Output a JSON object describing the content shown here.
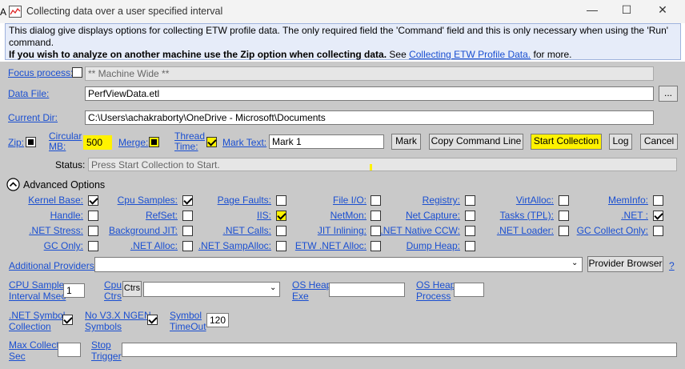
{
  "window": {
    "title": "Collecting data over a user specified interval",
    "minimize": "—",
    "maximize": "☐",
    "close": "✕"
  },
  "info": {
    "line1": "This dialog give displays options for collecting ETW profile data. The only required field the 'Command' field and this is only necessary when using the 'Run'",
    "line2": "command.",
    "line3_bold": "If you wish to analyze on another machine use the Zip option when collecting data.",
    "line3_see": " See ",
    "line3_link": "Collecting ETW Profile Data.",
    "line3_tail": " for more."
  },
  "form": {
    "focus_process_label": "Focus process:",
    "focus_process_value": "** Machine Wide **",
    "data_file_label": "Data File:",
    "data_file_value": "PerfViewData.etl",
    "browse_label": "...",
    "current_dir_label": "Current Dir:",
    "current_dir_value": "C:\\Users\\achakraborty\\OneDrive - Microsoft\\Documents",
    "zip_label": "Zip:",
    "circular_label_1": "Circular",
    "circular_label_2": "MB:",
    "circular_value": "500",
    "merge_label": "Merge:",
    "thread_time_label_1": "Thread",
    "thread_time_label_2": "Time:",
    "mark_text_label": "Mark Text:",
    "mark_text_value": "Mark 1",
    "mark_button": "Mark",
    "copy_command_button": "Copy Command Line",
    "start_collection_button": "Start Collection",
    "log_button": "Log",
    "cancel_button": "Cancel",
    "status_label": "Status:",
    "status_value": "Press Start Collection to Start."
  },
  "advanced": {
    "toggle_icon": "chevron-up-icon",
    "label": "Advanced Options",
    "options": [
      {
        "label": "Kernel Base:",
        "checked": true
      },
      {
        "label": "Cpu Samples:",
        "checked": true
      },
      {
        "label": "Page Faults:",
        "checked": false
      },
      {
        "label": "File I/O:",
        "checked": false
      },
      {
        "label": "Registry:",
        "checked": false
      },
      {
        "label": "VirtAlloc:",
        "checked": false
      },
      {
        "label": "MemInfo:",
        "checked": false
      },
      {
        "label": "Handle:",
        "checked": false
      },
      {
        "label": "RefSet:",
        "checked": false
      },
      {
        "label": "IIS:",
        "checked": true
      },
      {
        "label": "NetMon:",
        "checked": false
      },
      {
        "label": "Net Capture:",
        "checked": false
      },
      {
        "label": "Tasks (TPL):",
        "checked": false
      },
      {
        "label": ".NET :",
        "checked": true
      },
      {
        "label": ".NET Stress:",
        "checked": false
      },
      {
        "label": "Background JIT:",
        "checked": false
      },
      {
        "label": ".NET Calls:",
        "checked": false
      },
      {
        "label": "JIT Inlining:",
        "checked": false
      },
      {
        "label": ".NET Native CCW:",
        "checked": false
      },
      {
        "label": ".NET Loader:",
        "checked": false
      },
      {
        "label": "GC Collect Only:",
        "checked": false
      },
      {
        "label": "GC Only:",
        "checked": false
      },
      {
        "label": ".NET Alloc:",
        "checked": false
      },
      {
        "label": ".NET SampAlloc:",
        "checked": false
      },
      {
        "label": "ETW .NET Alloc:",
        "checked": false
      },
      {
        "label": "Dump Heap:",
        "checked": false
      }
    ],
    "additional_providers_label": "Additional Providers:",
    "additional_providers_value": "",
    "provider_browser_button": "Provider Browser",
    "help_link": "?",
    "cpu_sample_label_1": "CPU Sample",
    "cpu_sample_label_2": "Interval Msec",
    "cpu_sample_value": "1",
    "cpu_ctrs_label_1": "Cpu",
    "cpu_ctrs_label_2": "Ctrs",
    "ctrs_button": "Ctrs",
    "cpu_ctrs_value": "",
    "os_heap_exe_label_1": "OS Heap",
    "os_heap_exe_label_2": "Exe",
    "os_heap_exe_value": "",
    "os_heap_process_label_1": "OS Heap",
    "os_heap_process_label_2": "Process",
    "os_heap_process_value": "",
    "net_symbol_label_1": ".NET Symbol",
    "net_symbol_label_2": "Collection",
    "no_ngen_label_1": "No V3.X NGEN",
    "no_ngen_label_2": "Symbols",
    "symbol_timeout_label_1": "Symbol",
    "symbol_timeout_label_2": "TimeOut",
    "symbol_timeout_value": "120",
    "max_collect_label_1": "Max Collect",
    "max_collect_label_2": "Sec",
    "max_collect_value": "",
    "stop_trigger_label_1": "Stop",
    "stop_trigger_label_2": "Trigger",
    "stop_trigger_value": ""
  }
}
